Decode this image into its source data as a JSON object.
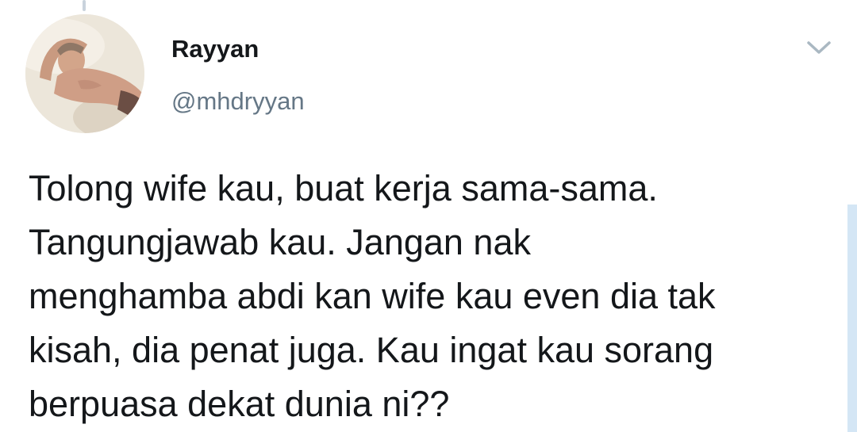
{
  "tweet": {
    "author": {
      "display_name": "Rayyan",
      "handle": "@mhdryyan"
    },
    "text_lines": [
      "Tolong wife kau, buat kerja sama-sama.",
      "Tangungjawab kau. Jangan nak",
      "menghamba abdi kan wife kau even dia tak",
      "kisah, dia penat juga. Kau ingat kau sorang",
      "berpuasa dekat dunia ni??"
    ],
    "menu_icon": "chevron-down-icon"
  },
  "colors": {
    "text_primary": "#14171a",
    "text_secondary": "#657786",
    "chevron": "#aab8c2",
    "scrollbar": "#d4e6f5",
    "background": "#ffffff"
  }
}
